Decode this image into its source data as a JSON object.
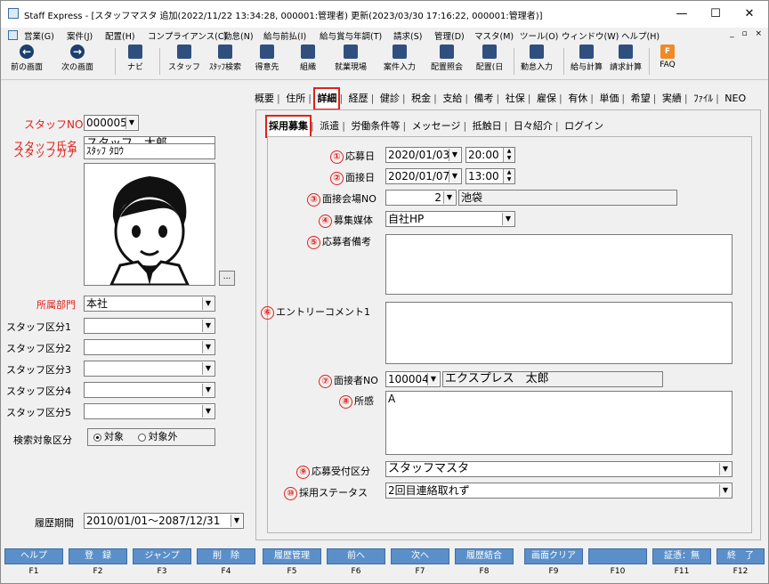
{
  "window": {
    "title": "Staff Express - [スタッフマスタ 追加(2022/11/22 13:34:28, 000001:管理者) 更新(2023/03/30 17:16:22, 000001:管理者)]",
    "minimize": "—",
    "maximize": "☐",
    "close": "✕"
  },
  "menu": [
    "営業(G)",
    "案件(J)",
    "配置(H)",
    "コンプライアンス(C)",
    "勤怠(N)",
    "給与前払(I)",
    "給与賞与年調(T)",
    "請求(S)",
    "管理(D)",
    "マスタ(M)",
    "ツール(O)",
    "ウィンドウ(W)",
    "ヘルプ(H)"
  ],
  "mdi_controls": "_ ▫ ×",
  "toolbar": [
    {
      "label": "前の画面",
      "icon": "back-arrow-icon",
      "glyph": "←"
    },
    {
      "label": "次の画面",
      "icon": "forward-arrow-icon",
      "glyph": "→"
    },
    {
      "label": "ナビ",
      "icon": "navi-icon",
      "glyph": ""
    },
    {
      "label": "スタッフ",
      "icon": "staff-icon",
      "glyph": ""
    },
    {
      "label": "ｽﾀｯﾌ検索",
      "icon": "staff-search-icon",
      "glyph": ""
    },
    {
      "label": "得意先",
      "icon": "client-icon",
      "glyph": ""
    },
    {
      "label": "組織",
      "icon": "organization-icon",
      "glyph": ""
    },
    {
      "label": "就業現場",
      "icon": "worksite-icon",
      "glyph": ""
    },
    {
      "label": "案件入力",
      "icon": "job-entry-icon",
      "glyph": ""
    },
    {
      "label": "配置照会",
      "icon": "assignment-inquiry-icon",
      "glyph": ""
    },
    {
      "label": "配置(日",
      "icon": "assignment-daily-icon",
      "glyph": ""
    },
    {
      "label": "勤怠入力",
      "icon": "attendance-entry-icon",
      "glyph": ""
    },
    {
      "label": "給与計算",
      "icon": "payroll-icon",
      "glyph": ""
    },
    {
      "label": "請求計算",
      "icon": "billing-icon",
      "glyph": ""
    },
    {
      "label": "FAQ",
      "icon": "faq-icon",
      "glyph": "FAQ"
    }
  ],
  "left": {
    "staff_no_label": "スタッフNO",
    "staff_no": "000005",
    "staff_name_label": "スタッフ氏名",
    "staff_name": "スタッフ　太郎",
    "staff_kana_label": "スタッフカナ",
    "staff_kana": "ｽﾀｯﾌ ﾀﾛｳ",
    "photo_button": "...",
    "dept_label": "所属部門",
    "dept": "本社",
    "div1_label": "スタッフ区分1",
    "div2_label": "スタッフ区分2",
    "div3_label": "スタッフ区分3",
    "div4_label": "スタッフ区分4",
    "div5_label": "スタッフ区分5",
    "search_label": "検索対象区分",
    "search_opt1": "対象",
    "search_opt2": "対象外",
    "history_label": "履歴期間",
    "history": "2010/01/01～2087/12/31"
  },
  "tabs1": [
    "概要",
    "住所",
    "詳細",
    "経歴",
    "健診",
    "税金",
    "支給",
    "備考",
    "社保",
    "雇保",
    "有休",
    "単価",
    "希望",
    "実績",
    "ﾌｧｲﾙ",
    "NEO"
  ],
  "tabs2": [
    "採用募集",
    "派遣",
    "労働条件等",
    "メッセージ",
    "抵触日",
    "日々紹介",
    "ログイン"
  ],
  "form": {
    "apply_date_num": "①",
    "apply_date_label": "応募日",
    "apply_date": "2020/01/03",
    "apply_time": "20:00",
    "interview_date_num": "②",
    "interview_date_label": "面接日",
    "interview_date": "2020/01/07",
    "interview_time": "13:00",
    "venue_num": "③",
    "venue_label": "面接会場NO",
    "venue_no": "2",
    "venue_name": "池袋",
    "media_num": "④",
    "media_label": "募集媒体",
    "media": "自社HP",
    "applicant_note_num": "⑤",
    "applicant_note_label": "応募者備考",
    "applicant_note": "",
    "entry_comment_num": "⑥",
    "entry_comment_label": "エントリーコメント1",
    "entry_comment": "",
    "interviewer_num": "⑦",
    "interviewer_label": "面接者NO",
    "interviewer_no": "100004",
    "interviewer_name": "エクスプレス　太郎",
    "impression_num": "⑧",
    "impression_label": "所感",
    "impression": "A",
    "reception_num": "⑨",
    "reception_label": "応募受付区分",
    "reception": "スタッフマスタ",
    "status_num": "⑩",
    "status_label": "採用ステータス",
    "status": "2回目連絡取れず"
  },
  "fkeys": [
    {
      "label": "ヘルプ",
      "key": "F1"
    },
    {
      "label": "登　録",
      "key": "F2"
    },
    {
      "label": "ジャンプ",
      "key": "F3"
    },
    {
      "label": "削　除",
      "key": "F4"
    },
    {
      "label": "履歴管理",
      "key": "F5"
    },
    {
      "label": "前へ",
      "key": "F6"
    },
    {
      "label": "次へ",
      "key": "F7"
    },
    {
      "label": "履歴結合",
      "key": "F8"
    },
    {
      "label": "画面クリア",
      "key": "F9"
    },
    {
      "label": "",
      "key": "F10"
    },
    {
      "label": "証憑：無",
      "key": "F11"
    },
    {
      "label": "終　了",
      "key": "F12"
    }
  ],
  "colors": {
    "accent_red": "#e0201a",
    "fkey_blue": "#5b8fc9"
  }
}
